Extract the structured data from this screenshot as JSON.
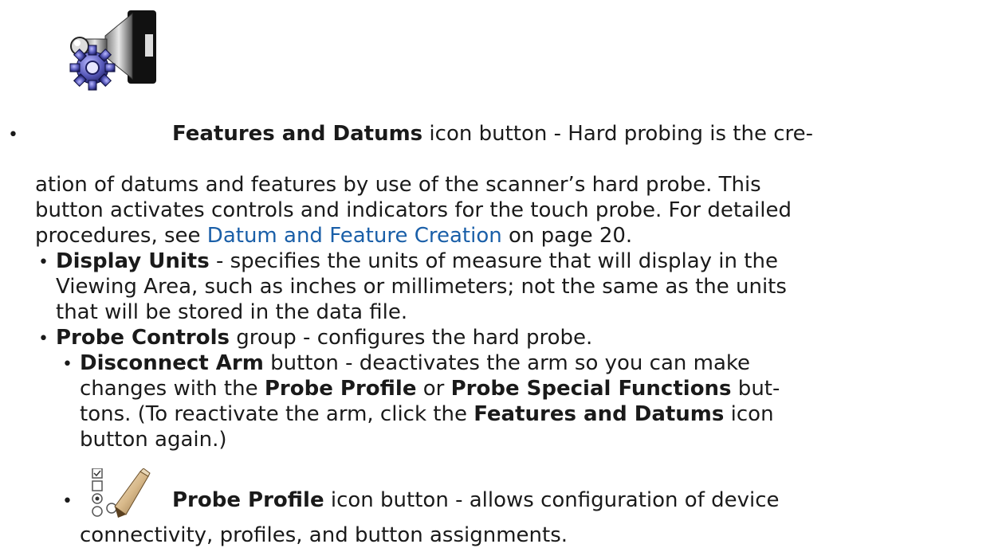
{
  "item1": {
    "icon": "features-and-datums-icon",
    "title": "Features and Datums",
    "line1_rest": " icon button - Hard probing is the cre-",
    "line2": "ation of datums and features by use of the scanner’s hard probe. This",
    "line3": "button activates controls and indicators for the touch probe. For detailed",
    "line4_pre": "procedures, see ",
    "link": "Datum and Feature Creation",
    "line4_post": " on page 20."
  },
  "display_units": {
    "title": "Display Units",
    "line1_rest": " - specifies the units of measure that will display in the",
    "line2": "Viewing Area, such as inches or millimeters; not the same as the units",
    "line3": "that will be stored in the data file."
  },
  "probe_controls": {
    "title": "Probe Controls",
    "rest": " group - configures the hard probe."
  },
  "disconnect_arm": {
    "title": "Disconnect Arm",
    "line1_rest": " button - deactivates the arm so you can make",
    "line2_pre": "changes with the ",
    "bold_a": "Probe Profile",
    "line2_mid": " or ",
    "bold_b": "Probe Special Functions",
    "line2_post": " but-",
    "line3_pre": "tons. (To reactivate the arm, click the ",
    "bold_c": "Features and Datums",
    "line3_post": " icon",
    "line4": "button again.)"
  },
  "probe_profile": {
    "icon": "probe-profile-icon",
    "title": "Probe Profile",
    "line1_rest": " icon button - allows configuration of device",
    "line2": "connectivity, profiles, and button assignments."
  },
  "bullet_char": "•"
}
